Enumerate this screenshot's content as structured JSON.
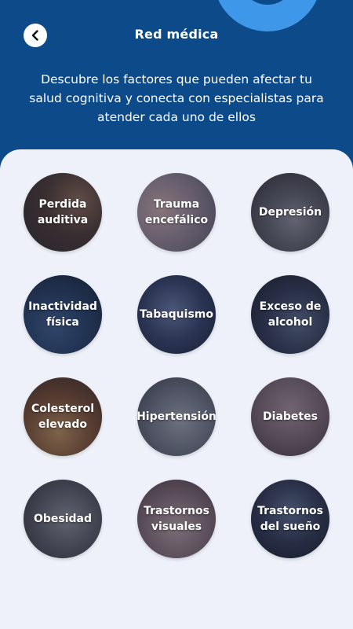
{
  "header": {
    "title": "Red médica",
    "subtitle": "Descubre los factores que pueden afectar tu salud cognitiva y conecta con especialistas para atender cada uno de ellos",
    "back_icon": "chevron-left-icon"
  },
  "colors": {
    "header_bg": "#0d4a8a",
    "accent": "#3f97ea",
    "panel_bg": "#eef1f9"
  },
  "factors": [
    {
      "label": "Perdida\nauditiva"
    },
    {
      "label": "Trauma\nencefálico"
    },
    {
      "label": "Depresión"
    },
    {
      "label": "Inactividad\nfísica"
    },
    {
      "label": "Tabaquismo"
    },
    {
      "label": "Exceso de\nalcohol"
    },
    {
      "label": "Colesterol\nelevado"
    },
    {
      "label": "Hipertensión"
    },
    {
      "label": "Diabetes"
    },
    {
      "label": "Obesidad"
    },
    {
      "label": "Trastornos\nvisuales"
    },
    {
      "label": "Trastornos\ndel sueño"
    }
  ]
}
